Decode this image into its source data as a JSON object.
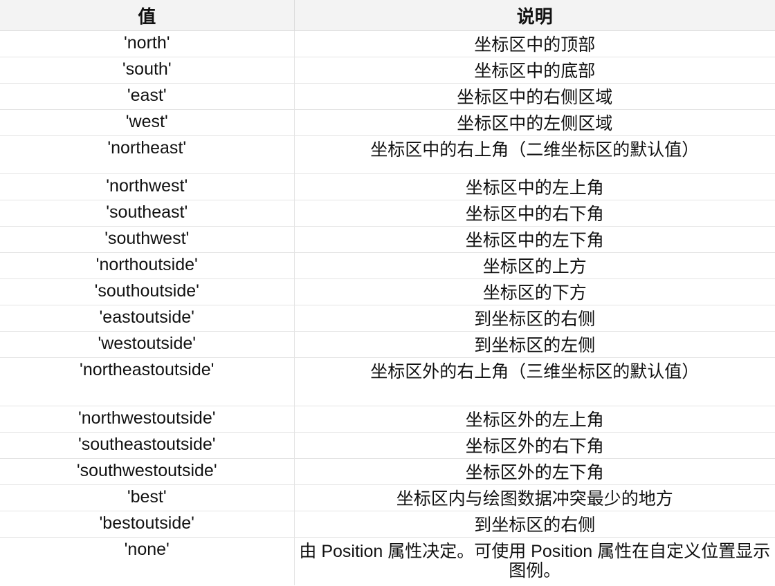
{
  "table": {
    "headers": {
      "value": "值",
      "description": "说明"
    },
    "rows": [
      {
        "value": "'north'",
        "description": "坐标区中的顶部"
      },
      {
        "value": "'south'",
        "description": "坐标区中的底部"
      },
      {
        "value": "'east'",
        "description": "坐标区中的右侧区域"
      },
      {
        "value": "'west'",
        "description": "坐标区中的左侧区域"
      },
      {
        "value": "'northeast'",
        "description": "坐标区中的右上角（二维坐标区的默认值）"
      },
      {
        "value": "'northwest'",
        "description": "坐标区中的左上角"
      },
      {
        "value": "'southeast'",
        "description": "坐标区中的右下角"
      },
      {
        "value": "'southwest'",
        "description": "坐标区中的左下角"
      },
      {
        "value": "'northoutside'",
        "description": "坐标区的上方"
      },
      {
        "value": "'southoutside'",
        "description": "坐标区的下方"
      },
      {
        "value": "'eastoutside'",
        "description": "到坐标区的右侧"
      },
      {
        "value": "'westoutside'",
        "description": "到坐标区的左侧"
      },
      {
        "value": "'northeastoutside'",
        "description": "坐标区外的右上角（三维坐标区的默认值）"
      },
      {
        "value": "'northwestoutside'",
        "description": "坐标区外的左上角"
      },
      {
        "value": "'southeastoutside'",
        "description": "坐标区外的右下角"
      },
      {
        "value": "'southwestoutside'",
        "description": "坐标区外的左下角"
      },
      {
        "value": "'best'",
        "description": "坐标区内与绘图数据冲突最少的地方"
      },
      {
        "value": "'bestoutside'",
        "description": "到坐标区的右侧"
      },
      {
        "value": "'none'",
        "description": "由 Position 属性决定。可使用 Position 属性在自定义位置显示图例。"
      }
    ]
  }
}
